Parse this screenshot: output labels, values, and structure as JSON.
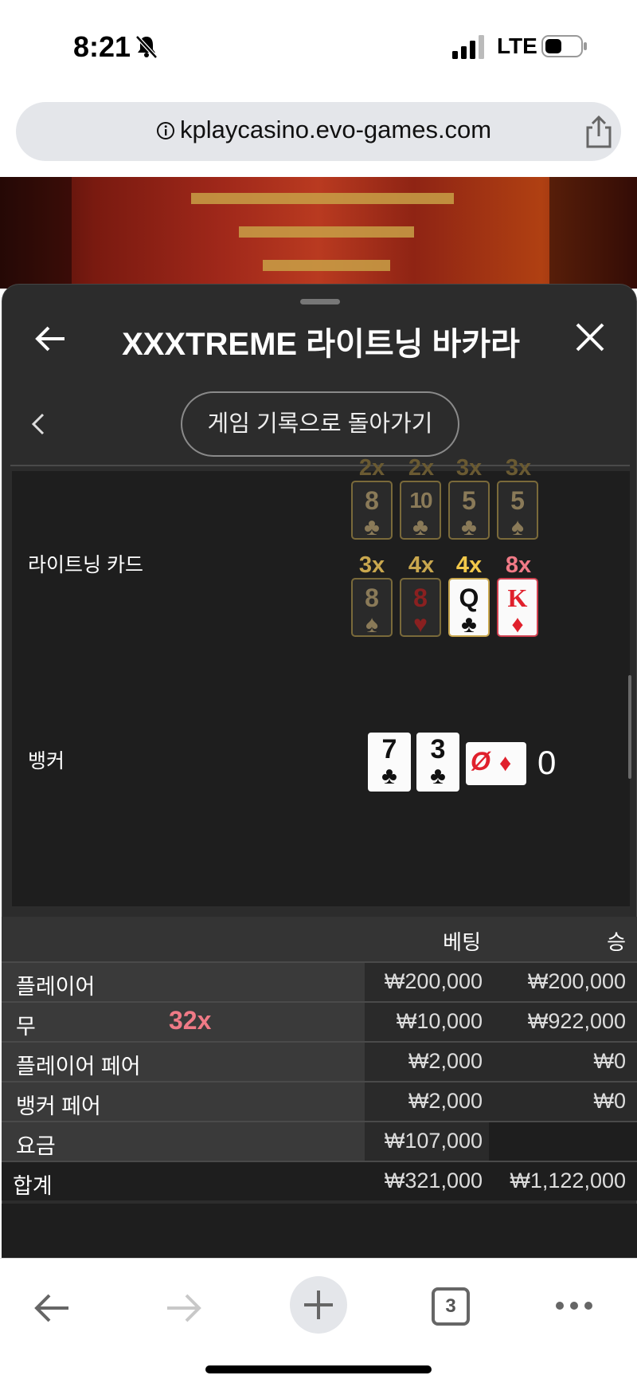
{
  "status": {
    "time": "8:21",
    "network": "LTE"
  },
  "browser": {
    "url": "kplaycasino.evo-games.com",
    "tab_count": "3"
  },
  "panel": {
    "title": "XXXTREME 라이트닝 바카라",
    "back_to_history": "게임 기록으로 돌아가기"
  },
  "lightning": {
    "label": "라이트닝 카드",
    "row1": [
      {
        "mult": "2x",
        "rank": "8",
        "suit": "♣"
      },
      {
        "mult": "2x",
        "rank": "10",
        "suit": "♣"
      },
      {
        "mult": "3x",
        "rank": "5",
        "suit": "♣"
      },
      {
        "mult": "3x",
        "rank": "5",
        "suit": "♠"
      }
    ],
    "row2": [
      {
        "mult": "3x",
        "rank": "8",
        "suit": "♠"
      },
      {
        "mult": "4x",
        "rank": "8",
        "suit": "♥"
      },
      {
        "mult": "4x",
        "rank": "Q",
        "suit": "♣"
      },
      {
        "mult": "8x",
        "rank": "K",
        "suit": "♦"
      }
    ]
  },
  "banker": {
    "label": "뱅커",
    "cards": [
      {
        "rank": "7",
        "suit": "♣"
      },
      {
        "rank": "3",
        "suit": "♣"
      },
      {
        "rank": "Ø",
        "suit": "♦"
      }
    ],
    "score": "0"
  },
  "bets_table": {
    "headers": {
      "bet": "베팅",
      "win": "승"
    },
    "rows": [
      {
        "label": "플레이어",
        "bet": "₩200,000",
        "win": "₩200,000",
        "multiplier": ""
      },
      {
        "label": "무",
        "bet": "₩10,000",
        "win": "₩922,000",
        "multiplier": "32x"
      },
      {
        "label": "플레이어 페어",
        "bet": "₩2,000",
        "win": "₩0",
        "multiplier": ""
      },
      {
        "label": "뱅커 페어",
        "bet": "₩2,000",
        "win": "₩0",
        "multiplier": ""
      },
      {
        "label": "요금",
        "bet": "₩107,000",
        "win": "",
        "multiplier": ""
      }
    ],
    "total": {
      "label": "합계",
      "bet": "₩321,000",
      "win": "₩1,122,000"
    }
  }
}
